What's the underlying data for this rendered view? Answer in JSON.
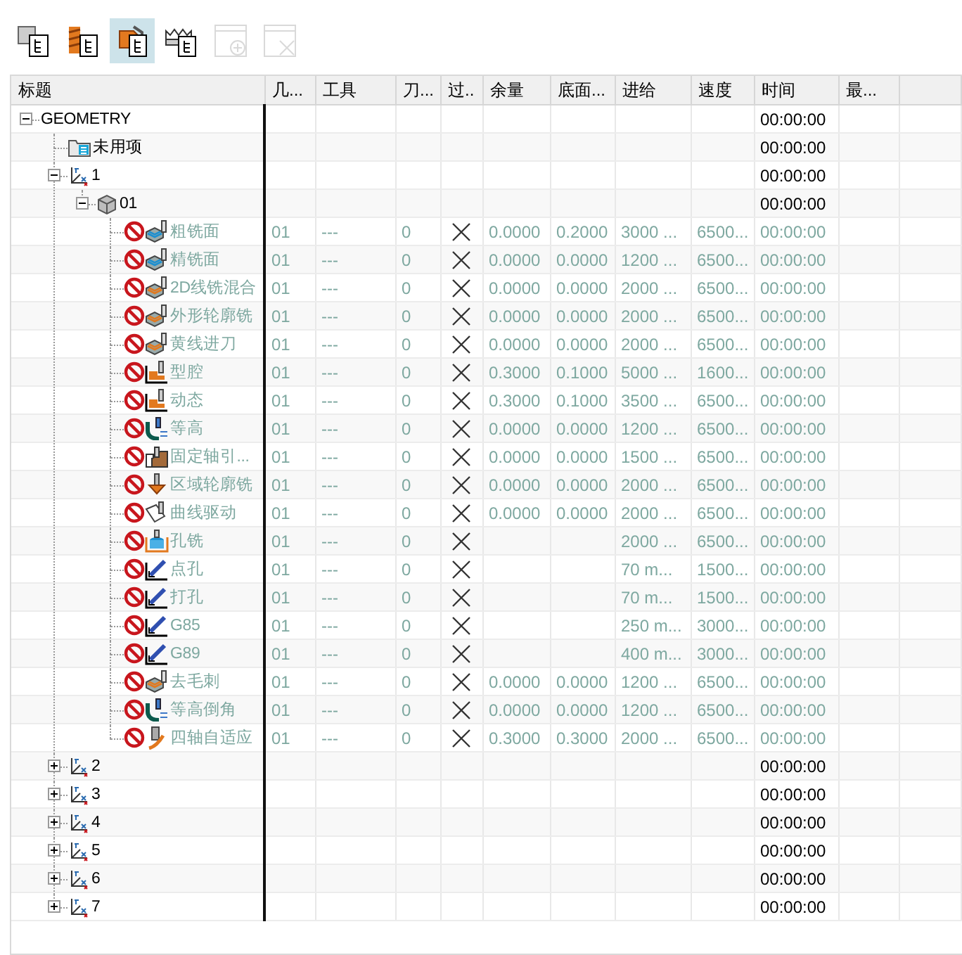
{
  "toolbar": [
    {
      "kind": "program-order",
      "selected": false,
      "disabled": false
    },
    {
      "kind": "machine-tool",
      "selected": false,
      "disabled": false
    },
    {
      "kind": "geometry",
      "selected": true,
      "disabled": false
    },
    {
      "kind": "method",
      "selected": false,
      "disabled": false
    },
    {
      "kind": "add-window",
      "selected": false,
      "disabled": true
    },
    {
      "kind": "close-window",
      "selected": false,
      "disabled": true
    }
  ],
  "columns": [
    "标题",
    "几...",
    "工具",
    "刀...",
    "过..",
    "余量",
    "底面...",
    "进给",
    "速度",
    "时间",
    "最..."
  ],
  "tree": [
    {
      "name": "GEOMETRY",
      "time": "00:00:00",
      "expanded": true,
      "children": [
        {
          "kind": "folder",
          "name": "未用项",
          "time": "00:00:00"
        },
        {
          "kind": "mcs",
          "name": "1",
          "time": "00:00:00",
          "expanded": true,
          "children": [
            {
              "kind": "workpiece",
              "name": "01",
              "time": "00:00:00",
              "expanded": true,
              "children": [
                {
                  "kind": "face",
                  "name": "粗铣面",
                  "not_generated": true,
                  "geometry": "01",
                  "tool": "---",
                  "tool_number": "0",
                  "verified": false,
                  "stock": "0.0000",
                  "floor_stock": "0.2000",
                  "feed": "3000 ...",
                  "speed": "6500...",
                  "time": "00:00:00"
                },
                {
                  "kind": "face",
                  "name": "精铣面",
                  "not_generated": true,
                  "geometry": "01",
                  "tool": "---",
                  "tool_number": "0",
                  "verified": false,
                  "stock": "0.0000",
                  "floor_stock": "0.0000",
                  "feed": "1200 ...",
                  "speed": "6500...",
                  "time": "00:00:00"
                },
                {
                  "kind": "planar",
                  "name": "2D线铣混合",
                  "not_generated": true,
                  "geometry": "01",
                  "tool": "---",
                  "tool_number": "0",
                  "verified": false,
                  "stock": "0.0000",
                  "floor_stock": "0.0000",
                  "feed": "2000 ...",
                  "speed": "6500...",
                  "time": "00:00:00"
                },
                {
                  "kind": "planar",
                  "name": "外形轮廓铣",
                  "not_generated": true,
                  "geometry": "01",
                  "tool": "---",
                  "tool_number": "0",
                  "verified": false,
                  "stock": "0.0000",
                  "floor_stock": "0.0000",
                  "feed": "2000 ...",
                  "speed": "6500...",
                  "time": "00:00:00"
                },
                {
                  "kind": "planar",
                  "name": "黄线进刀",
                  "not_generated": true,
                  "geometry": "01",
                  "tool": "---",
                  "tool_number": "0",
                  "verified": false,
                  "stock": "0.0000",
                  "floor_stock": "0.0000",
                  "feed": "2000 ...",
                  "speed": "6500...",
                  "time": "00:00:00"
                },
                {
                  "kind": "cavity",
                  "name": "型腔",
                  "not_generated": true,
                  "geometry": "01",
                  "tool": "---",
                  "tool_number": "0",
                  "verified": false,
                  "stock": "0.3000",
                  "floor_stock": "0.1000",
                  "feed": "5000 ...",
                  "speed": "1600...",
                  "time": "00:00:00"
                },
                {
                  "kind": "cavity",
                  "name": "动态",
                  "not_generated": true,
                  "geometry": "01",
                  "tool": "---",
                  "tool_number": "0",
                  "verified": false,
                  "stock": "0.3000",
                  "floor_stock": "0.1000",
                  "feed": "3500 ...",
                  "speed": "6500...",
                  "time": "00:00:00"
                },
                {
                  "kind": "zlevel",
                  "name": "等高",
                  "not_generated": true,
                  "geometry": "01",
                  "tool": "---",
                  "tool_number": "0",
                  "verified": false,
                  "stock": "0.0000",
                  "floor_stock": "0.0000",
                  "feed": "1200 ...",
                  "speed": "6500...",
                  "time": "00:00:00"
                },
                {
                  "kind": "fixed",
                  "name": "固定轴引...",
                  "not_generated": true,
                  "geometry": "01",
                  "tool": "---",
                  "tool_number": "0",
                  "verified": false,
                  "stock": "0.0000",
                  "floor_stock": "0.0000",
                  "feed": "1500 ...",
                  "speed": "6500...",
                  "time": "00:00:00"
                },
                {
                  "kind": "area",
                  "name": "区域轮廓铣",
                  "not_generated": true,
                  "geometry": "01",
                  "tool": "---",
                  "tool_number": "0",
                  "verified": false,
                  "stock": "0.0000",
                  "floor_stock": "0.0000",
                  "feed": "2000 ...",
                  "speed": "6500...",
                  "time": "00:00:00"
                },
                {
                  "kind": "curve",
                  "name": "曲线驱动",
                  "not_generated": true,
                  "geometry": "01",
                  "tool": "---",
                  "tool_number": "0",
                  "verified": false,
                  "stock": "0.0000",
                  "floor_stock": "0.0000",
                  "feed": "2000 ...",
                  "speed": "6500...",
                  "time": "00:00:00"
                },
                {
                  "kind": "hole-mill",
                  "name": "孔铣",
                  "not_generated": true,
                  "geometry": "01",
                  "tool": "---",
                  "tool_number": "0",
                  "verified": false,
                  "feed": "2000 ...",
                  "speed": "6500...",
                  "time": "00:00:00"
                },
                {
                  "kind": "drill",
                  "name": "点孔",
                  "not_generated": true,
                  "geometry": "01",
                  "tool": "---",
                  "tool_number": "0",
                  "verified": false,
                  "feed": "70 m...",
                  "speed": "1500...",
                  "time": "00:00:00"
                },
                {
                  "kind": "drill",
                  "name": "打孔",
                  "not_generated": true,
                  "geometry": "01",
                  "tool": "---",
                  "tool_number": "0",
                  "verified": false,
                  "feed": "70 m...",
                  "speed": "1500...",
                  "time": "00:00:00"
                },
                {
                  "kind": "drill",
                  "name": "G85",
                  "not_generated": true,
                  "geometry": "01",
                  "tool": "---",
                  "tool_number": "0",
                  "verified": false,
                  "feed": "250 m...",
                  "speed": "3000...",
                  "time": "00:00:00"
                },
                {
                  "kind": "drill",
                  "name": "G89",
                  "not_generated": true,
                  "geometry": "01",
                  "tool": "---",
                  "tool_number": "0",
                  "verified": false,
                  "feed": "400 m...",
                  "speed": "3000...",
                  "time": "00:00:00"
                },
                {
                  "kind": "planar",
                  "name": "去毛刺",
                  "not_generated": true,
                  "geometry": "01",
                  "tool": "---",
                  "tool_number": "0",
                  "verified": false,
                  "stock": "0.0000",
                  "floor_stock": "0.0000",
                  "feed": "1200 ...",
                  "speed": "6500...",
                  "time": "00:00:00"
                },
                {
                  "kind": "zlevel",
                  "name": "等高倒角",
                  "not_generated": true,
                  "geometry": "01",
                  "tool": "---",
                  "tool_number": "0",
                  "verified": false,
                  "stock": "0.0000",
                  "floor_stock": "0.0000",
                  "feed": "1200 ...",
                  "speed": "6500...",
                  "time": "00:00:00"
                },
                {
                  "kind": "multi",
                  "name": "四轴自适应",
                  "not_generated": true,
                  "geometry": "01",
                  "tool": "---",
                  "tool_number": "0",
                  "verified": false,
                  "stock": "0.3000",
                  "floor_stock": "0.3000",
                  "feed": "2000 ...",
                  "speed": "6500...",
                  "time": "00:00:00"
                }
              ]
            }
          ]
        },
        {
          "kind": "mcs",
          "name": "2",
          "time": "00:00:00",
          "expanded": false
        },
        {
          "kind": "mcs",
          "name": "3",
          "time": "00:00:00",
          "expanded": false
        },
        {
          "kind": "mcs",
          "name": "4",
          "time": "00:00:00",
          "expanded": false
        },
        {
          "kind": "mcs",
          "name": "5",
          "time": "00:00:00",
          "expanded": false
        },
        {
          "kind": "mcs",
          "name": "6",
          "time": "00:00:00",
          "expanded": false
        },
        {
          "kind": "mcs",
          "name": "7",
          "time": "00:00:00",
          "expanded": false
        }
      ]
    }
  ]
}
